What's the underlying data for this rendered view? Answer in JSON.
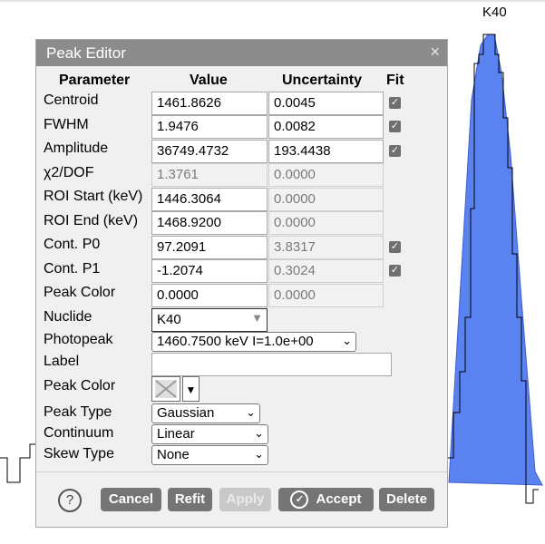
{
  "chart": {
    "peak_label": "K40",
    "peak_color": "#5b82f1"
  },
  "dialog": {
    "title": "Peak Editor",
    "close_icon": "×",
    "headers": {
      "parameter": "Parameter",
      "value": "Value",
      "uncertainty": "Uncertainty",
      "fit": "Fit"
    },
    "rows": [
      {
        "label": "Centroid",
        "value": "1461.8626",
        "uncertainty": "0.0045",
        "fit": true
      },
      {
        "label": "FWHM",
        "value": "1.9476",
        "uncertainty": "0.0082",
        "fit": true
      },
      {
        "label": "Amplitude",
        "value": "36749.4732",
        "uncertainty": "193.4438",
        "fit": true
      },
      {
        "label": "χ2/DOF",
        "value": "1.3761",
        "uncertainty": "0.0000"
      },
      {
        "label": "ROI Start (keV)",
        "value": "1446.3064",
        "uncertainty": "0.0000"
      },
      {
        "label": "ROI End (keV)",
        "value": "1468.9200",
        "uncertainty": "0.0000"
      },
      {
        "label": "Cont. P0",
        "value": "97.2091",
        "uncertainty": "3.8317",
        "fit": true
      },
      {
        "label": "Cont. P1",
        "value": "-1.2074",
        "uncertainty": "0.3024",
        "fit": true
      },
      {
        "label": "Peak Color",
        "value": "0.0000",
        "uncertainty": "0.0000"
      }
    ],
    "nuclide": {
      "label": "Nuclide",
      "value": "K40"
    },
    "photopeak": {
      "label": "Photopeak",
      "value": "1460.7500 keV I=1.0e+00"
    },
    "label_field": {
      "label": "Label",
      "value": ""
    },
    "peak_color": {
      "label": "Peak Color"
    },
    "peak_type": {
      "label": "Peak Type",
      "value": "Gaussian"
    },
    "continuum": {
      "label": "Continuum",
      "value": "Linear"
    },
    "skew_type": {
      "label": "Skew Type",
      "value": "None"
    },
    "buttons": {
      "help": "?",
      "cancel": "Cancel",
      "refit": "Refit",
      "apply": "Apply",
      "accept": "Accept",
      "delete": "Delete"
    }
  }
}
